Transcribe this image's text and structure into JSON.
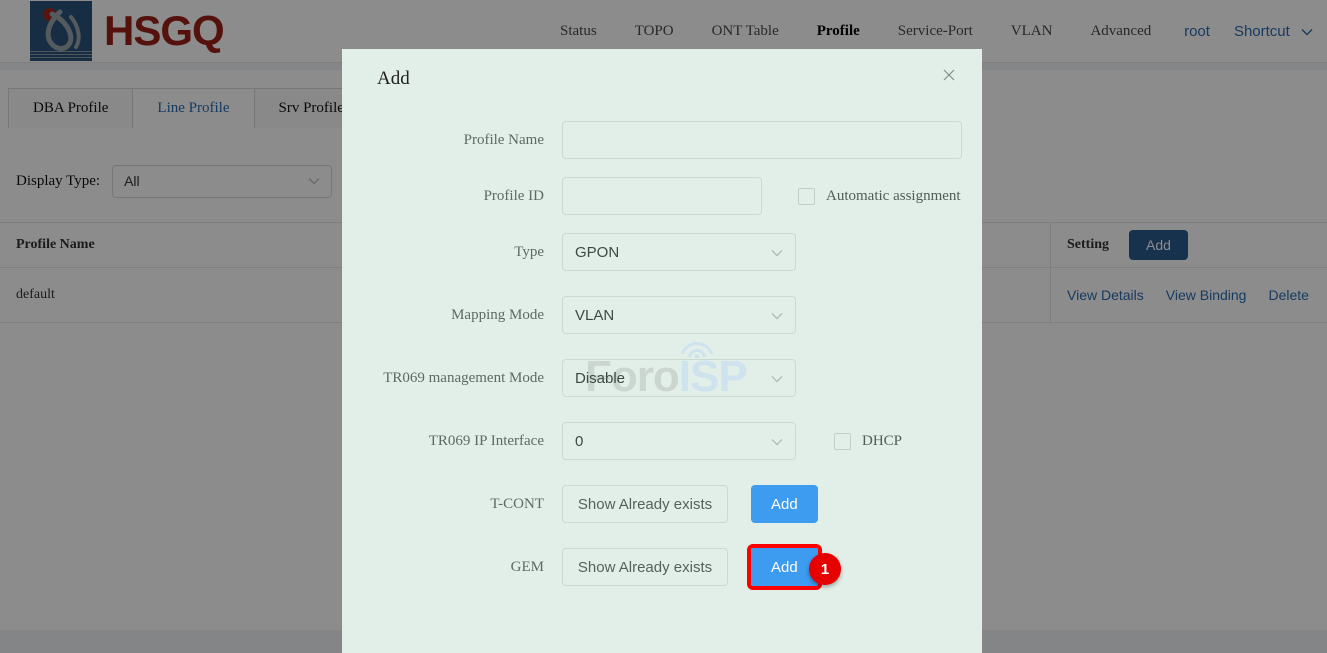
{
  "header": {
    "brand": "HSGQ",
    "logo_icon": "hsgq-flame-logo-icon",
    "nav": [
      {
        "label": "Status",
        "active": false
      },
      {
        "label": "TOPO",
        "active": false
      },
      {
        "label": "ONT Table",
        "active": false
      },
      {
        "label": "Profile",
        "active": true
      },
      {
        "label": "Service-Port",
        "active": false
      },
      {
        "label": "VLAN",
        "active": false
      },
      {
        "label": "Advanced",
        "active": false
      }
    ],
    "user": "root",
    "shortcut": "Shortcut",
    "shortcut_icon": "chevron-down-icon",
    "brand_color": "#9b2017",
    "link_color": "#2b6cb0"
  },
  "tabs": [
    {
      "label": "DBA Profile",
      "active": false
    },
    {
      "label": "Line Profile",
      "active": true
    },
    {
      "label": "Srv Profile",
      "active": false
    }
  ],
  "filter": {
    "label": "Display Type:",
    "value": "All",
    "arrow_icon": "chevron-down-icon"
  },
  "table": {
    "columns": [
      "Profile Name",
      "Setting"
    ],
    "header_add_label": "Add",
    "rows": [
      {
        "profile_name": "default",
        "actions": [
          "View Details",
          "View Binding",
          "Delete"
        ]
      }
    ]
  },
  "modal": {
    "title": "Add",
    "close_icon": "close-icon",
    "watermark": {
      "part1": "Foro",
      "part2": "ISP"
    },
    "fields": {
      "profile_name": {
        "label": "Profile Name",
        "value": "",
        "placeholder": ""
      },
      "profile_id": {
        "label": "Profile ID",
        "value": "",
        "placeholder": ""
      },
      "automatic_assignment": {
        "label": "Automatic assignment",
        "checked": false
      },
      "type": {
        "label": "Type",
        "value": "GPON",
        "arrow_icon": "chevron-down-icon"
      },
      "mapping_mode": {
        "label": "Mapping Mode",
        "value": "VLAN",
        "arrow_icon": "chevron-down-icon"
      },
      "tr069_management_mode": {
        "label": "TR069 management Mode",
        "value": "Disable",
        "arrow_icon": "chevron-down-icon"
      },
      "tr069_ip_interface": {
        "label": "TR069 IP Interface",
        "value": "0",
        "arrow_icon": "chevron-down-icon"
      },
      "dhcp": {
        "label": "DHCP",
        "checked": false
      },
      "tcont": {
        "label": "T-CONT",
        "show_label": "Show Already exists",
        "add_label": "Add"
      },
      "gem": {
        "label": "GEM",
        "show_label": "Show Already exists",
        "add_label": "Add"
      }
    },
    "background_color": "#e2efe8"
  },
  "annotation": {
    "badge_number": "1",
    "badge_color": "#e60000",
    "highlight_color": "#ff0000"
  }
}
